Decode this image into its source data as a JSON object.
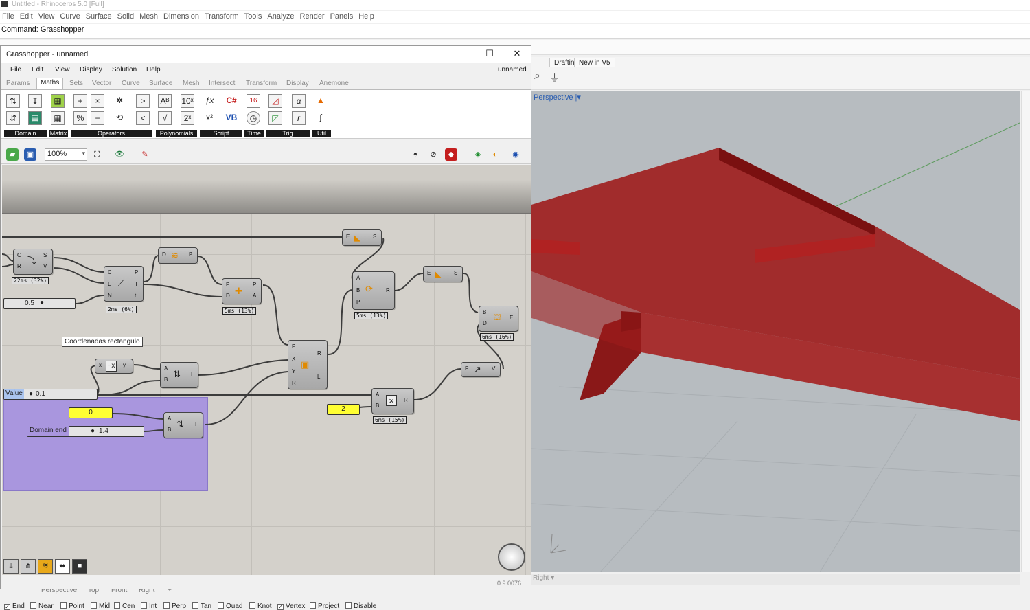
{
  "rhino": {
    "title": "Untitled - Rhinoceros 5.0 [Full]",
    "menu": [
      "File",
      "Edit",
      "View",
      "Curve",
      "Surface",
      "Solid",
      "Mesh",
      "Dimension",
      "Transform",
      "Tools",
      "Analyze",
      "Render",
      "Panels",
      "Help"
    ],
    "command": "Command: Grasshopper",
    "toolbar_tabs": [
      "Drafting",
      "New in V5"
    ],
    "viewport_label": "Perspective",
    "bottom_view_label": "Right",
    "view_tabs": [
      "Perspective",
      "Top",
      "Front",
      "Right"
    ],
    "osnaps": [
      {
        "label": "End",
        "checked": true
      },
      {
        "label": "Near",
        "checked": false
      },
      {
        "label": "Point",
        "checked": false
      },
      {
        "label": "Mid",
        "checked": false
      },
      {
        "label": "Cen",
        "checked": false
      },
      {
        "label": "Int",
        "checked": false
      },
      {
        "label": "Perp",
        "checked": false
      },
      {
        "label": "Tan",
        "checked": false
      },
      {
        "label": "Quad",
        "checked": false
      },
      {
        "label": "Knot",
        "checked": false
      },
      {
        "label": "Vertex",
        "checked": true
      },
      {
        "label": "Project",
        "checked": false
      },
      {
        "label": "Disable",
        "checked": false
      }
    ],
    "colors": {
      "solid": "#9e1c1c",
      "viewport_bg": "#b7bcc0"
    }
  },
  "gh": {
    "title": "Grasshopper - unnamed",
    "doc_name": "unnamed",
    "menu": [
      "File",
      "Edit",
      "View",
      "Display",
      "Solution",
      "Help"
    ],
    "tabs": [
      "Params",
      "Maths",
      "Sets",
      "Vector",
      "Curve",
      "Surface",
      "Mesh",
      "Intersect",
      "Transform",
      "Display",
      "Anemone"
    ],
    "active_tab": "Maths",
    "ribbon_groups": [
      "Domain",
      "Matrix",
      "Operators",
      "Polynomials",
      "Script",
      "Time",
      "Trig",
      "Util"
    ],
    "zoom": "100%",
    "version": "0.9.0076",
    "canvas": {
      "tooltip": "Coordenadas rectangulo",
      "slider_value_label": "Value",
      "slider_value": "0.1",
      "slider_05": "0.5",
      "slider_domain_label": "Domain end",
      "slider_domain": "1.4",
      "panel_zero": "0",
      "panel_two": "2",
      "timings": [
        "22ms (32%)",
        "2ms (6%)",
        "5ms (13%)",
        "5ms (13%)",
        "6ms (16%)",
        "6ms (15%)"
      ]
    }
  }
}
